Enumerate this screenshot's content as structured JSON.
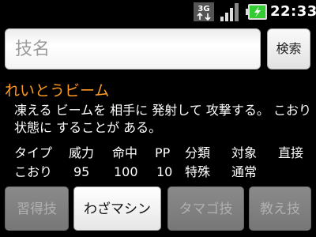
{
  "status_bar": {
    "network_icon": "3g-data-icon",
    "signal_icon": "signal-strength-icon",
    "battery_icon": "battery-charging-icon",
    "time": "22:33",
    "network_label": "3G"
  },
  "search": {
    "placeholder": "技名",
    "value": "",
    "button_label": "検索"
  },
  "move": {
    "name": "れいとうビーム",
    "description": "凍える ビームを 相手に 発射して 攻撃する。 こおり状態に することが ある。",
    "stats": {
      "headers": [
        "タイプ",
        "威力",
        "命中",
        "PP",
        "分類",
        "対象",
        "直接"
      ],
      "values": [
        "こおり",
        "95",
        "100",
        "10",
        "特殊",
        "通常",
        ""
      ]
    }
  },
  "tabs": [
    {
      "label": "習得技",
      "active": false
    },
    {
      "label": "わざマシン",
      "active": true
    },
    {
      "label": "タマゴ技",
      "active": false
    },
    {
      "label": "教え技",
      "active": false
    }
  ],
  "colors": {
    "move_name": "#ff9a1e",
    "background": "#000000"
  }
}
